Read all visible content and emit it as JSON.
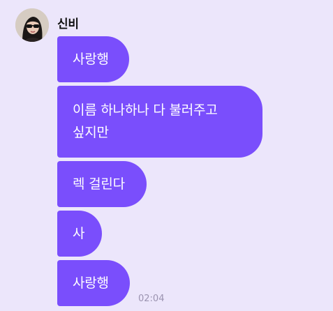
{
  "sender": {
    "name": "신비"
  },
  "messages": [
    {
      "text": "사랑행"
    },
    {
      "text": "이름 하나하나 다 불러주고\n싶지만"
    },
    {
      "text": "렉 걸린다"
    },
    {
      "text": "사"
    },
    {
      "text": "사랑행"
    }
  ],
  "last_message_time": "02:04",
  "colors": {
    "background": "#ece6fb",
    "bubble": "#7a4efc",
    "bubble_text": "#ffffff",
    "time_text": "#9b93b0"
  }
}
